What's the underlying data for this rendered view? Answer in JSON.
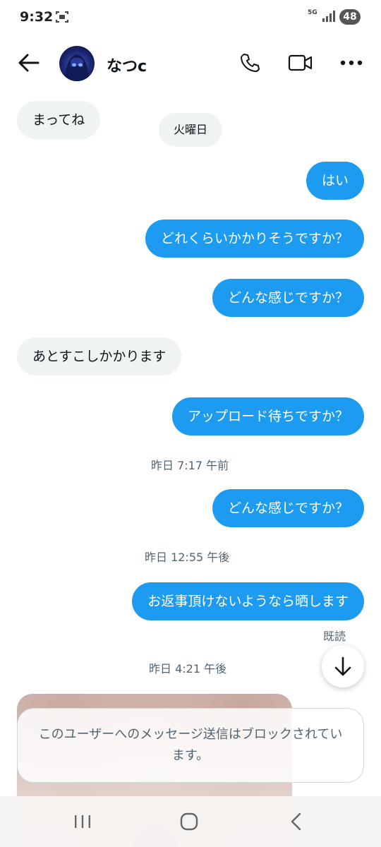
{
  "status_bar": {
    "time": "9:32",
    "network": "5G",
    "battery": "48"
  },
  "header": {
    "contact_name": "なつc"
  },
  "messages": [
    {
      "dir": "in",
      "text": "まってね"
    },
    {
      "dir": "out",
      "text": "はい"
    },
    {
      "dir": "out",
      "text": "どれくらいかかりそうですか？"
    },
    {
      "dir": "out",
      "text": "どんな感じですか？"
    },
    {
      "dir": "in",
      "text": "あとすこしかかります"
    },
    {
      "dir": "out",
      "text": "アップロード待ちですか？"
    },
    {
      "dir": "out",
      "text": "どんな感じですか？"
    },
    {
      "dir": "out",
      "text": "お返事頂けないようなら晒します"
    }
  ],
  "day_separator": "火曜日",
  "timestamps": [
    "昨日 7:17 午前",
    "昨日 12:55 午後",
    "昨日 4:21 午後"
  ],
  "read_receipt": "既読",
  "blocked_notice": "このユーザーへのメッセージ送信はブロックされています。",
  "icons": {
    "back": "arrow-left",
    "call": "phone",
    "video": "video-camera",
    "more": "ellipsis",
    "scroll": "arrow-down"
  },
  "colors": {
    "outgoing_bubble": "#1d9bf0",
    "incoming_bubble": "#eff3f4",
    "secondary_text": "#536471"
  }
}
